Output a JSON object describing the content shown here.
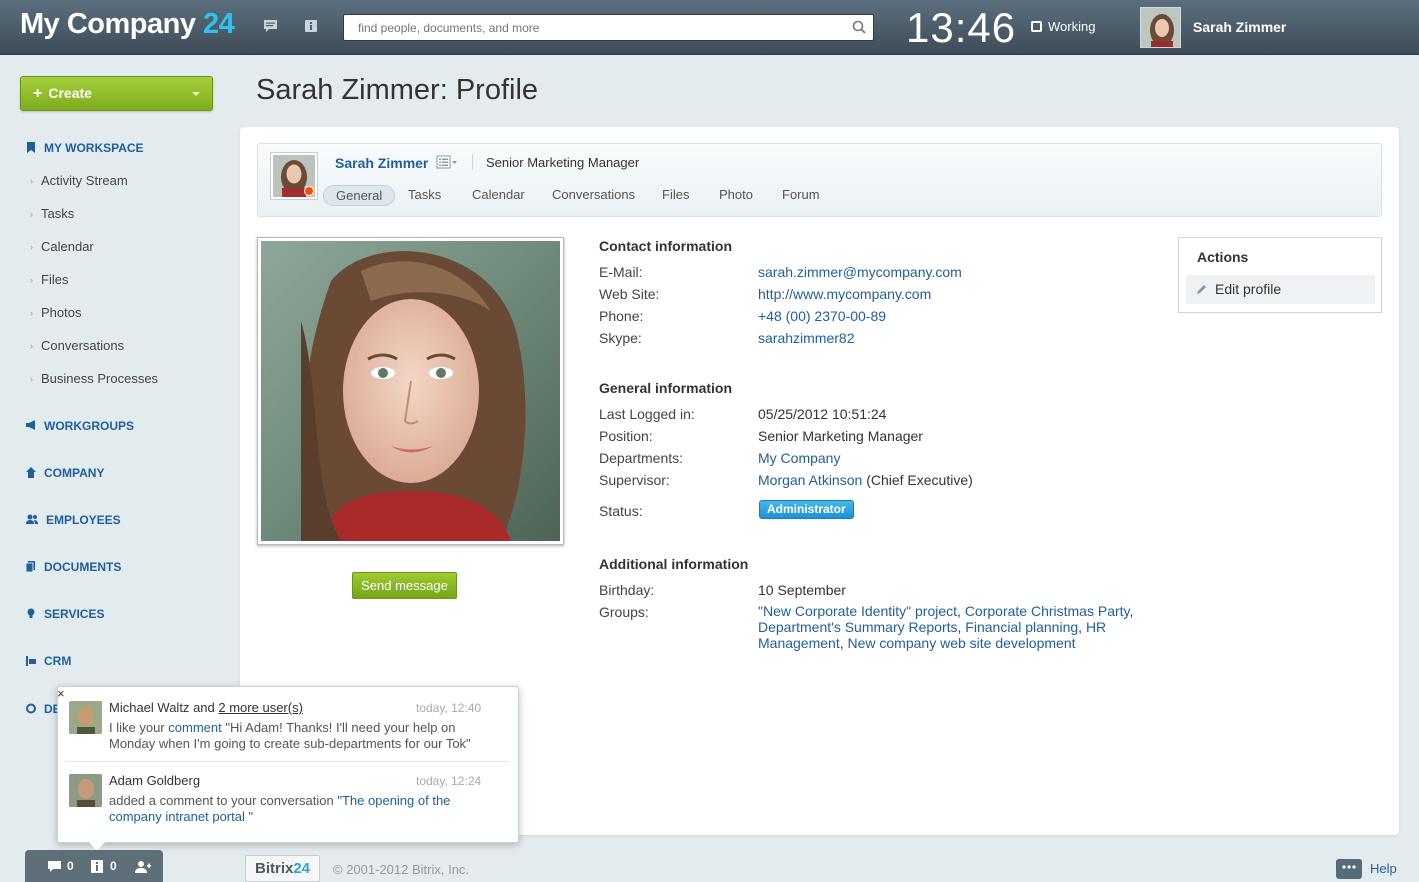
{
  "header": {
    "logo_text": "My Company",
    "logo_num": "24",
    "search_placeholder": "find people, documents, and more",
    "clock": "13:46",
    "work_status": "Working",
    "user_name": "Sarah Zimmer"
  },
  "sidebar": {
    "create_label": "Create",
    "workspace_label": "MY WORKSPACE",
    "workspace_items": [
      "Activity Stream",
      "Tasks",
      "Calendar",
      "Files",
      "Photos",
      "Conversations",
      "Business Processes"
    ],
    "sections": [
      "WORKGROUPS",
      "COMPANY",
      "EMPLOYEES",
      "DOCUMENTS",
      "SERVICES",
      "CRM",
      "DE"
    ]
  },
  "page": {
    "title": "Sarah Zimmer: Profile"
  },
  "profile": {
    "name": "Sarah Zimmer",
    "job_title": "Senior Marketing Manager",
    "tabs": [
      "General",
      "Tasks",
      "Calendar",
      "Conversations",
      "Files",
      "Photo",
      "Forum"
    ],
    "send_message": "Send message",
    "contact_heading": "Contact information",
    "contact": {
      "email_label": "E-Mail:",
      "email": "sarah.zimmer@mycompany.com",
      "web_label": "Web Site:",
      "web": "http://www.mycompany.com",
      "phone_label": "Phone:",
      "phone": "+48 (00) 2370-00-89",
      "skype_label": "Skype:",
      "skype": "sarahzimmer82"
    },
    "general_heading": "General information",
    "general": {
      "last_label": "Last Logged in:",
      "last": "05/25/2012 10:51:24",
      "position_label": "Position:",
      "position": "Senior Marketing Manager",
      "dept_label": "Departments:",
      "dept": "My Company",
      "supervisor_label": "Supervisor:",
      "supervisor": "Morgan Atkinson",
      "supervisor_role": "(Chief Executive)",
      "status_label": "Status:",
      "status": "Administrator"
    },
    "additional_heading": "Additional information",
    "additional": {
      "birthday_label": "Birthday:",
      "birthday": "10 September",
      "groups_label": "Groups:",
      "groups": [
        "\"New Corporate Identity\" project",
        "Corporate Christmas Party",
        "Department's Summary Reports",
        "Financial planning",
        "HR Management",
        "New company web site development"
      ]
    }
  },
  "actions": {
    "title": "Actions",
    "edit": "Edit profile"
  },
  "notifications": {
    "n1": {
      "name": "Michael Waltz",
      "and": "and",
      "more": "2 more user(s)",
      "time": "today, 12:40",
      "text_pre": "I like your",
      "link": "comment",
      "text_post": "\"Hi Adam! Thanks! I'll need your help on Monday when I'm going to create sub-departments for our Tok\""
    },
    "n2": {
      "name": "Adam Goldberg",
      "time": "today, 12:24",
      "text_pre": "added a comment to your conversation",
      "link": "\"The opening of the company intranet portal",
      "text_post": "\""
    }
  },
  "bottom_bar": {
    "messages_count": "0",
    "notify_count": "0"
  },
  "footer": {
    "logo": "Bitrix",
    "logo_num": "24",
    "copyright": "© 2001-2012 Bitrix, Inc.",
    "help": "Help"
  }
}
